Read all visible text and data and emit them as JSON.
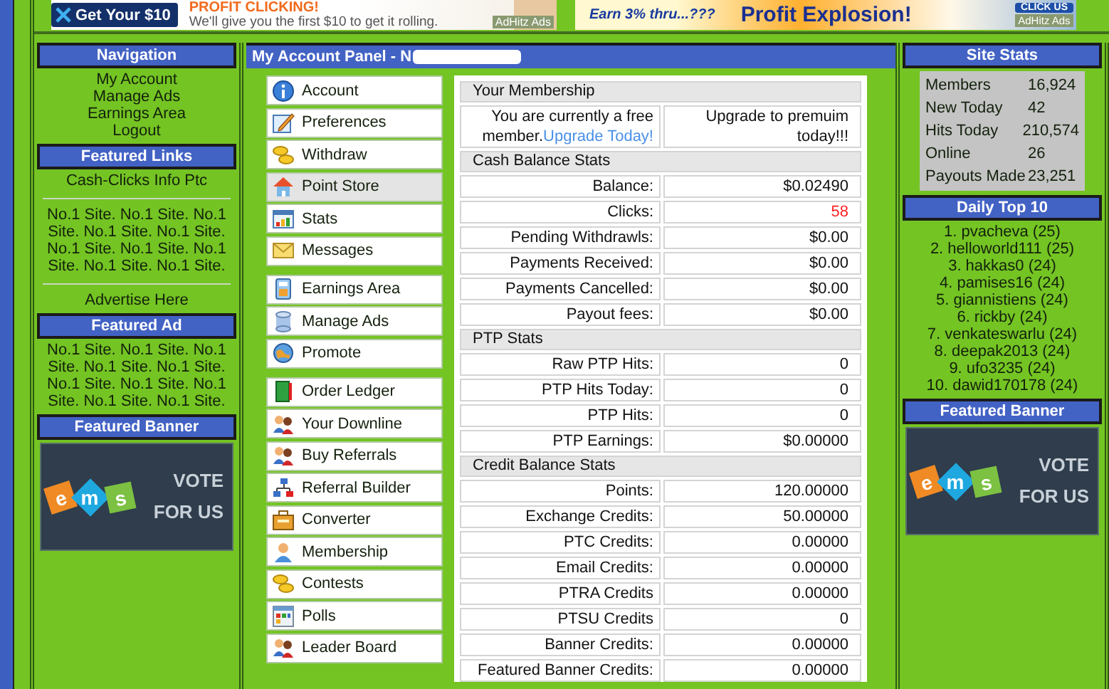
{
  "ads": [
    {
      "kind": "profit",
      "button": "Get Your $10",
      "headline": "PROFIT CLICKING!",
      "tagline": "We'll give you the first $10 to get it rolling.",
      "network": "AdHitz Ads"
    },
    {
      "kind": "explosion",
      "teaser": "Earn 3% thru...???",
      "headline": "Profit Explosion!",
      "button": "CLICK US",
      "network": "AdHitz Ads"
    }
  ],
  "navigation": {
    "title": "Navigation",
    "links": [
      "My Account",
      "Manage Ads",
      "Earnings Area",
      "Logout"
    ]
  },
  "featured_links": {
    "title": "Featured Links",
    "links": [
      "Cash-Clicks Info Ptc"
    ],
    "ad_lines": [
      "No.1 Site. No.1 Site. No.1",
      "Site. No.1 Site. No.1 Site.",
      "No.1 Site. No.1 Site. No.1",
      "Site. No.1 Site. No.1 Site."
    ],
    "advertise": "Advertise Here"
  },
  "featured_ad": {
    "title": "Featured Ad",
    "lines": [
      "No.1 Site. No.1 Site. No.1",
      "Site. No.1 Site. No.1 Site.",
      "No.1 Site. No.1 Site. No.1",
      "Site. No.1 Site. No.1 Site."
    ]
  },
  "left_banner": {
    "title": "Featured Banner",
    "letters": [
      "e",
      "m",
      "s"
    ],
    "caption": [
      "VOTE",
      "FOR US"
    ]
  },
  "panel": {
    "title": "My Account Panel - N",
    "menu_groups": [
      [
        {
          "label": "Account",
          "selected": false
        },
        {
          "label": "Preferences",
          "selected": false
        },
        {
          "label": "Withdraw",
          "selected": false
        },
        {
          "label": "Point Store",
          "selected": true
        },
        {
          "label": "Stats",
          "selected": false
        },
        {
          "label": "Messages",
          "selected": false
        }
      ],
      [
        {
          "label": "Earnings Area",
          "selected": false
        },
        {
          "label": "Manage Ads",
          "selected": false
        },
        {
          "label": "Promote",
          "selected": false
        }
      ],
      [
        {
          "label": "Order Ledger",
          "selected": false
        },
        {
          "label": "Your Downline",
          "selected": false
        },
        {
          "label": "Buy Referrals",
          "selected": false
        },
        {
          "label": "Referral Builder",
          "selected": false
        },
        {
          "label": "Converter",
          "selected": false
        },
        {
          "label": "Membership",
          "selected": false
        },
        {
          "label": "Contests",
          "selected": false
        },
        {
          "label": "Polls",
          "selected": false
        },
        {
          "label": "Leader Board",
          "selected": false
        }
      ]
    ],
    "sections": [
      {
        "title": "Your Membership",
        "rows": [
          {
            "label": "You are currently a free member.",
            "link": "Upgrade Today!",
            "value": "Upgrade to premuim today!!!"
          }
        ]
      },
      {
        "title": "Cash Balance Stats",
        "rows": [
          {
            "label": "Balance:",
            "value": "$0.02490"
          },
          {
            "label": "Clicks:",
            "value": "58",
            "color": "#ff2020"
          },
          {
            "label": "Pending Withdrawls:",
            "value": "$0.00"
          },
          {
            "label": "Payments Received:",
            "value": "$0.00"
          },
          {
            "label": "Payments Cancelled:",
            "value": "$0.00"
          },
          {
            "label": "Payout fees:",
            "value": "$0.00"
          }
        ]
      },
      {
        "title": "PTP Stats",
        "rows": [
          {
            "label": "Raw PTP Hits:",
            "value": "0"
          },
          {
            "label": "PTP Hits Today:",
            "value": "0"
          },
          {
            "label": "PTP Hits:",
            "value": "0"
          },
          {
            "label": "PTP Earnings:",
            "value": "$0.00000"
          }
        ]
      },
      {
        "title": "Credit Balance Stats",
        "rows": [
          {
            "label": "Points:",
            "value": "120.00000"
          },
          {
            "label": "Exchange Credits:",
            "value": "50.00000"
          },
          {
            "label": "PTC Credits:",
            "value": "0.00000"
          },
          {
            "label": "Email Credits:",
            "value": "0.00000"
          },
          {
            "label": "PTRA Credits",
            "value": "0.00000"
          },
          {
            "label": "PTSU Credits",
            "value": "0"
          },
          {
            "label": "Banner Credits:",
            "value": "0.00000"
          },
          {
            "label": "Featured Banner Credits:",
            "value": "0.00000"
          }
        ]
      }
    ]
  },
  "site_stats": {
    "title": "Site Stats",
    "rows": [
      {
        "label": "Members",
        "value": "16,924"
      },
      {
        "label": "New Today",
        "value": "42"
      },
      {
        "label": "Hits Today",
        "value": "210,574"
      },
      {
        "label": "Online",
        "value": "26"
      },
      {
        "label": "Payouts Made",
        "value": "23,251"
      }
    ]
  },
  "daily_top": {
    "title": "Daily Top 10",
    "entries": [
      "1. pvacheva (25)",
      "2. helloworld111 (25)",
      "3. hakkas0 (24)",
      "4. pamises16 (24)",
      "5. giannistiens (24)",
      "6. rickby (24)",
      "7. venkateswarlu (24)",
      "8. deepak2013 (24)",
      "9. ufo3235 (24)",
      "10. dawid170178 (24)"
    ]
  },
  "right_banner": {
    "title": "Featured Banner",
    "letters": [
      "e",
      "m",
      "s"
    ],
    "caption": [
      "VOTE",
      "FOR US"
    ]
  }
}
